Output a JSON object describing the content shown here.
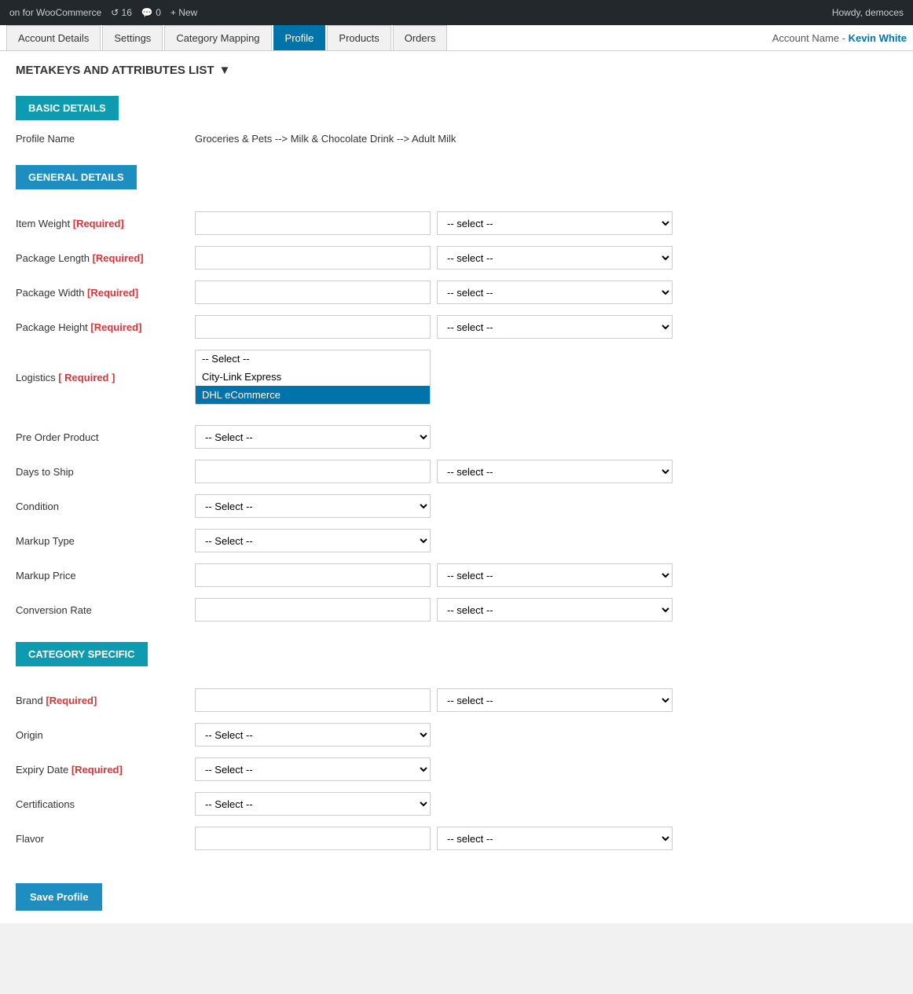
{
  "adminBar": {
    "pluginLabel": "on for WooCommerce",
    "notifCount": "16",
    "commentCount": "0",
    "newLabel": "+ New",
    "howdy": "Howdy, democes"
  },
  "tabs": [
    {
      "id": "account-details",
      "label": "Account Details",
      "active": false
    },
    {
      "id": "settings",
      "label": "Settings",
      "active": false
    },
    {
      "id": "category-mapping",
      "label": "Category Mapping",
      "active": false
    },
    {
      "id": "profile",
      "label": "Profile",
      "active": true
    },
    {
      "id": "products",
      "label": "Products",
      "active": false
    },
    {
      "id": "orders",
      "label": "Orders",
      "active": false
    }
  ],
  "accountInfo": {
    "label": "Account Name -",
    "name": "Kevin White"
  },
  "sectionHeading": "METAKEYS AND ATTRIBUTES LIST",
  "basicDetailsBtn": "BASIC DETAILS",
  "profileNameLabel": "Profile Name",
  "profileNameValue": "Groceries & Pets --> Milk & Chocolate Drink --> Adult Milk",
  "generalDetailsBtn": "GENERAL DETAILS",
  "fields": {
    "itemWeight": {
      "label": "Item Weight",
      "required": true,
      "type": "text+select"
    },
    "packageLength": {
      "label": "Package Length",
      "required": true,
      "type": "text+select"
    },
    "packageWidth": {
      "label": "Package Width",
      "required": true,
      "type": "text+select"
    },
    "packageHeight": {
      "label": "Package Height",
      "required": true,
      "type": "text+select"
    },
    "logistics": {
      "label": "Logistics",
      "required": true,
      "type": "listbox",
      "options": [
        "-- Select --",
        "City-Link Express",
        "DHL eCommerce"
      ],
      "selectedIndex": 2
    },
    "preOrderProduct": {
      "label": "Pre Order Product",
      "required": false,
      "type": "select"
    },
    "daysToShip": {
      "label": "Days to Ship",
      "required": false,
      "type": "text+select"
    },
    "condition": {
      "label": "Condition",
      "required": false,
      "type": "select"
    },
    "markupType": {
      "label": "Markup Type",
      "required": false,
      "type": "select"
    },
    "markupPrice": {
      "label": "Markup Price",
      "required": false,
      "type": "text+select"
    },
    "conversionRate": {
      "label": "Conversion Rate",
      "required": false,
      "type": "text+select"
    }
  },
  "categorySpecificBtn": "CATEGORY SPECIFIC",
  "categoryFields": {
    "brand": {
      "label": "Brand",
      "required": true,
      "type": "text+select"
    },
    "origin": {
      "label": "Origin",
      "required": false,
      "type": "select"
    },
    "expiryDate": {
      "label": "Expiry Date",
      "required": true,
      "type": "select"
    },
    "certifications": {
      "label": "Certifications",
      "required": false,
      "type": "select"
    },
    "flavor": {
      "label": "Flavor",
      "required": false,
      "type": "text+select"
    }
  },
  "selectPlaceholder": "-- Select --",
  "selectPlaceholderDash": "-- select --",
  "saveProfileLabel": "Save Profile"
}
